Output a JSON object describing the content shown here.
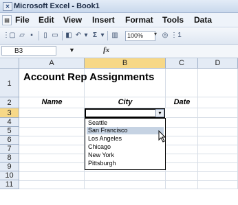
{
  "window": {
    "title": "Microsoft Excel - Book1",
    "icon": "excel-app-icon"
  },
  "menu": [
    "File",
    "Edit",
    "View",
    "Insert",
    "Format",
    "Tools",
    "Data"
  ],
  "toolbar": {
    "zoom": "100%",
    "extra": "1"
  },
  "formula_bar": {
    "name_box": "B3",
    "fx": "fx",
    "content": ""
  },
  "grid": {
    "columns": [
      "A",
      "B",
      "C",
      "D"
    ],
    "rows": [
      "1",
      "2",
      "3",
      "4",
      "5",
      "6",
      "7",
      "8",
      "9",
      "10",
      "11"
    ],
    "active_column": "B",
    "active_row": "3"
  },
  "sheet": {
    "title": "Account Rep Assignments",
    "headers": {
      "name": "Name",
      "city": "City",
      "date": "Date"
    }
  },
  "dropdown": {
    "options": [
      "Seattle",
      "San Francisco",
      "Los Angeles",
      "Chicago",
      "New York",
      "Pittsburgh"
    ],
    "highlighted": "San Francisco"
  },
  "colors": {
    "selection_highlight": "#c6d3e3",
    "active_header": "#f7d887",
    "header_bg": "#e4ebf5"
  }
}
